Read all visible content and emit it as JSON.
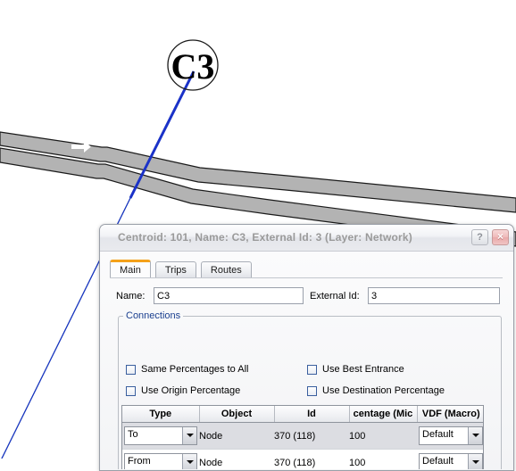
{
  "map": {
    "centroid_node": {
      "label": "C3",
      "shape": "circle-outline"
    },
    "road_arrows": [
      {
        "name": "road-arrow-east",
        "direction": "right"
      },
      {
        "name": "road-arrow-west",
        "direction": "left"
      }
    ],
    "colors": {
      "road_fill": "#b3b3b3",
      "road_border": "#1a1a1a",
      "connector_blue": "#1a32c8",
      "connector_green": "#1f7a4d",
      "arrow_fill": "#ffffff"
    }
  },
  "dialog": {
    "title": "Centroid: 101, Name: C3, External Id: 3 (Layer: Network)",
    "help_label": "?",
    "close_label": "×",
    "tabs": [
      {
        "label": "Main",
        "active": true
      },
      {
        "label": "Trips",
        "active": false
      },
      {
        "label": "Routes",
        "active": false
      }
    ],
    "fields": {
      "name_label": "Name:",
      "name_value": "C3",
      "external_id_label": "External Id:",
      "external_id_value": "3"
    },
    "connections": {
      "legend": "Connections",
      "checkboxes": [
        {
          "label": "Same Percentages to All",
          "checked": false
        },
        {
          "label": "Use Best Entrance",
          "checked": false
        },
        {
          "label": "Use Origin Percentage",
          "checked": false
        },
        {
          "label": "Use Destination Percentage",
          "checked": false
        }
      ],
      "table": {
        "columns": [
          "Type",
          "Object",
          "Id",
          "centage (Mic",
          "VDF (Macro)"
        ],
        "rows": [
          {
            "selected": true,
            "type": "To",
            "object": "Node",
            "id": "370 (118)",
            "percentage": "100",
            "vdf": "Default"
          },
          {
            "selected": false,
            "type": "From",
            "object": "Node",
            "id": "370 (118)",
            "percentage": "100",
            "vdf": "Default"
          }
        ]
      }
    }
  }
}
